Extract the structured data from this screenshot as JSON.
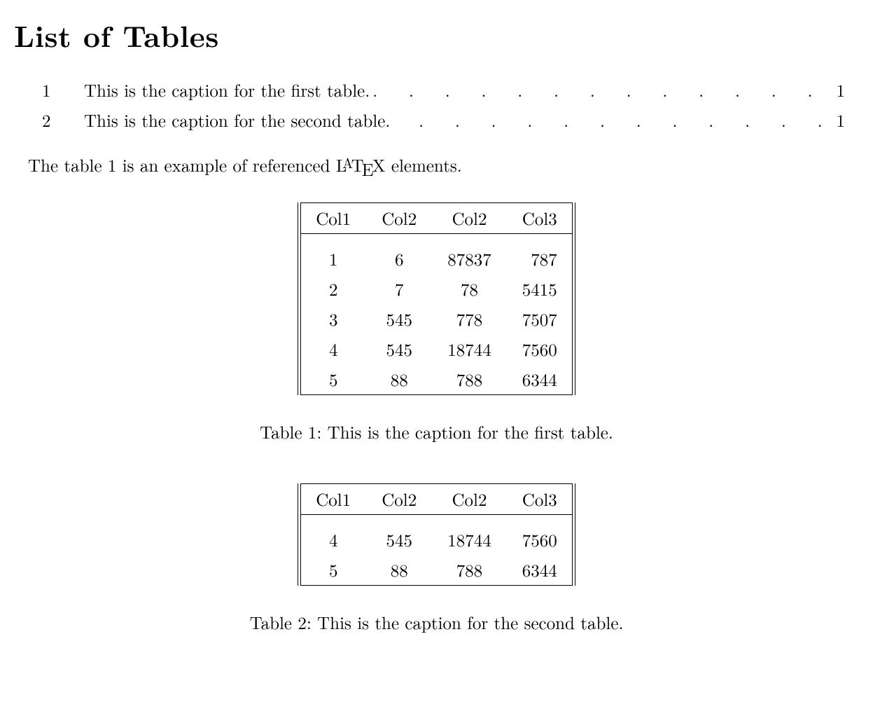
{
  "heading": "List of Tables",
  "lot": {
    "entries": [
      {
        "num": "1",
        "caption": "This is the caption for the first table.",
        "page": "1"
      },
      {
        "num": "2",
        "caption": "This is the caption for the second table.",
        "page": "1"
      }
    ]
  },
  "body_text_pre": "The table 1 is an example of referenced ",
  "body_text_post": " elements.",
  "latex_word": "LATEX",
  "tables": [
    {
      "caption_label": "Table 1:",
      "caption_text": "This is the caption for the first table.",
      "headers": [
        "Col1",
        "Col2",
        "Col2",
        "Col3"
      ],
      "rows": [
        [
          "1",
          "6",
          "87837",
          "787"
        ],
        [
          "2",
          "7",
          "78",
          "5415"
        ],
        [
          "3",
          "545",
          "778",
          "7507"
        ],
        [
          "4",
          "545",
          "18744",
          "7560"
        ],
        [
          "5",
          "88",
          "788",
          "6344"
        ]
      ]
    },
    {
      "caption_label": "Table 2:",
      "caption_text": "This is the caption for the second table.",
      "headers": [
        "Col1",
        "Col2",
        "Col2",
        "Col3"
      ],
      "rows": [
        [
          "4",
          "545",
          "18744",
          "7560"
        ],
        [
          "5",
          "88",
          "788",
          "6344"
        ]
      ]
    }
  ],
  "chart_data": [
    {
      "type": "table",
      "title": "Table 1: This is the caption for the first table.",
      "columns": [
        "Col1",
        "Col2",
        "Col2",
        "Col3"
      ],
      "rows": [
        [
          1,
          6,
          87837,
          787
        ],
        [
          2,
          7,
          78,
          5415
        ],
        [
          3,
          545,
          778,
          7507
        ],
        [
          4,
          545,
          18744,
          7560
        ],
        [
          5,
          88,
          788,
          6344
        ]
      ]
    },
    {
      "type": "table",
      "title": "Table 2: This is the caption for the second table.",
      "columns": [
        "Col1",
        "Col2",
        "Col2",
        "Col3"
      ],
      "rows": [
        [
          4,
          545,
          18744,
          7560
        ],
        [
          5,
          88,
          788,
          6344
        ]
      ]
    }
  ]
}
